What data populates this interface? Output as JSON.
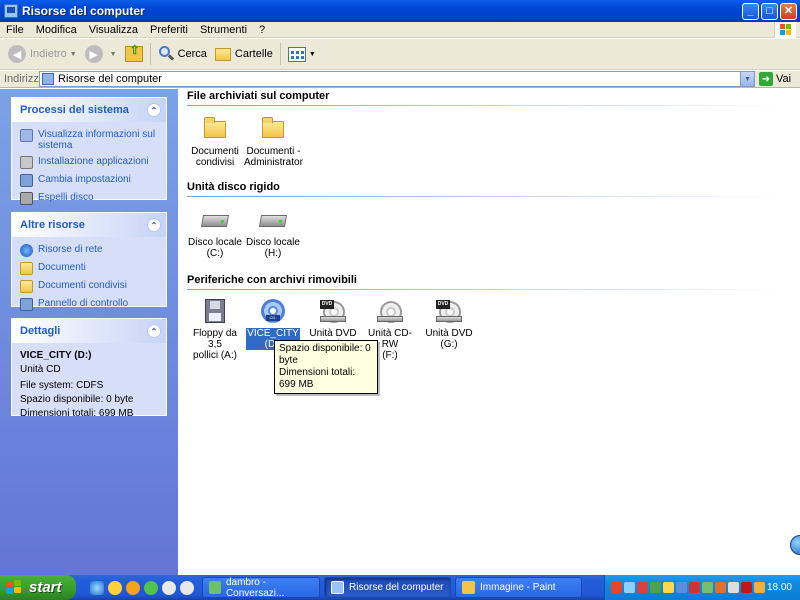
{
  "window": {
    "title": "Risorse del computer"
  },
  "menu": [
    "File",
    "Modifica",
    "Visualizza",
    "Preferiti",
    "Strumenti",
    "?"
  ],
  "toolbar": {
    "back": "Indietro",
    "search": "Cerca",
    "folders": "Cartelle"
  },
  "address": {
    "label": "Indirizzo",
    "value": "Risorse del computer",
    "go": "Vai"
  },
  "left": {
    "system": {
      "title": "Processi del sistema",
      "items": [
        "Visualizza informazioni sul sistema",
        "Installazione applicazioni",
        "Cambia impostazioni",
        "Espelli disco"
      ]
    },
    "other": {
      "title": "Altre risorse",
      "items": [
        "Risorse di rete",
        "Documenti",
        "Documenti condivisi",
        "Pannello di controllo"
      ]
    },
    "details": {
      "title": "Dettagli",
      "name": "VICE_CITY (D:)",
      "type": "Unità CD",
      "fs": "File system: CDFS",
      "free": "Spazio disponibile: 0 byte",
      "total": "Dimensioni totali: 699 MB"
    }
  },
  "groups": {
    "files": {
      "title": "File archiviati sul computer",
      "items": [
        {
          "line1": "Documenti",
          "line2": "condivisi"
        },
        {
          "line1": "Documenti -",
          "line2": "Administrator"
        }
      ]
    },
    "hdd": {
      "title": "Unità disco rigido",
      "items": [
        {
          "line1": "Disco locale",
          "line2": "(C:)"
        },
        {
          "line1": "Disco locale",
          "line2": "(H:)"
        }
      ]
    },
    "removable": {
      "title": "Periferiche con archivi rimovibili",
      "items": [
        {
          "line1": "Floppy da 3,5",
          "line2": "pollici (A:)"
        },
        {
          "line1": "VICE_CITY",
          "line2": "(D:)"
        },
        {
          "line1": "Unità DVD (E:)",
          "line2": ""
        },
        {
          "line1": "Unità CD-RW",
          "line2": "(F:)"
        },
        {
          "line1": "Unità DVD (G:)",
          "line2": ""
        }
      ],
      "cd_tag": "CD-ROM",
      "dvd_tag": "DVD"
    }
  },
  "tooltip": {
    "line1": "Spazio disponibile: 0 byte",
    "line2": "Dimensioni totali: 699 MB"
  },
  "taskbar": {
    "start": "start",
    "tasks": [
      "dambro - Conversazi...",
      "Risorse del computer",
      "Immagine - Paint"
    ],
    "clock": "18.00"
  }
}
